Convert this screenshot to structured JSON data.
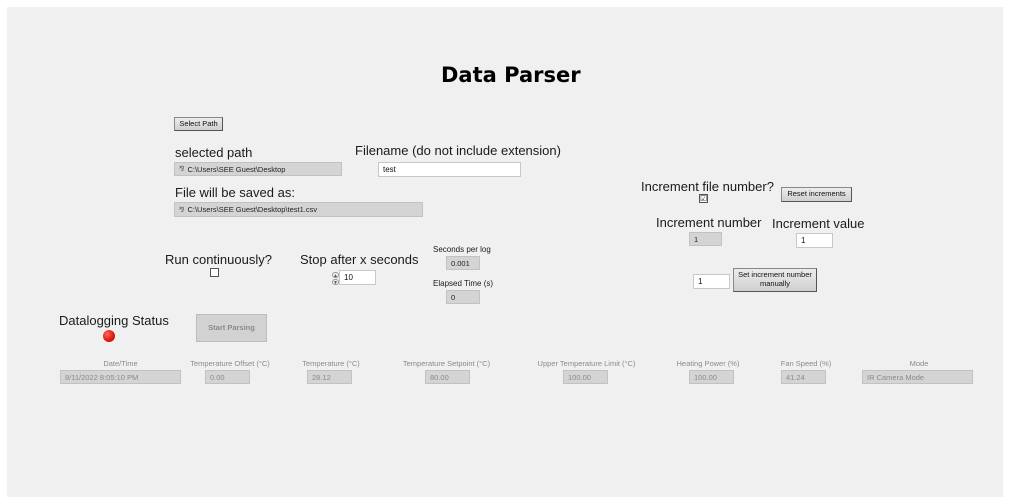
{
  "title": "Data Parser",
  "select_path_button": "Select Path",
  "selected_path": {
    "label": "selected path",
    "value": "C:\\Users\\SEE Guest\\Desktop"
  },
  "filename": {
    "label": "Filename (do not include extension)",
    "value": "test"
  },
  "saved_as": {
    "label": "File will be saved as:",
    "value": "C:\\Users\\SEE Guest\\Desktop\\test1.csv"
  },
  "increment": {
    "question": "Increment file number?",
    "checked": "☑",
    "reset_button": "Reset increments",
    "number_label": "Increment number",
    "number_value": "1",
    "value_label": "Increment value",
    "value_value": "1",
    "manual_value": "1",
    "manual_button": "Set increment number manually"
  },
  "run_continuously": {
    "label": "Run continuously?"
  },
  "stop_after": {
    "label": "Stop after x seconds",
    "value": "10"
  },
  "seconds_per_log": {
    "label": "Seconds per log",
    "value": "0.001"
  },
  "elapsed_time": {
    "label": "Elapsed Time (s)",
    "value": "0"
  },
  "datalogging": {
    "label": "Datalogging Status",
    "led_color": "#e01b10"
  },
  "start_button": "Start Parsing",
  "columns": [
    {
      "header": "Date/Time",
      "value": "8/11/2022 8:05:10 PM"
    },
    {
      "header": "Temperature Offset (°C)",
      "value": "0.00"
    },
    {
      "header": "Temperature (°C)",
      "value": "28.12"
    },
    {
      "header": "Temperature Setpoint (°C)",
      "value": "80.00"
    },
    {
      "header": "Upper Temperature Limit (°C)",
      "value": "100.00"
    },
    {
      "header": "Heating Power (%)",
      "value": "100.00"
    },
    {
      "header": "Fan Speed (%)",
      "value": "41.24"
    },
    {
      "header": "Mode",
      "value": "IR Camera Mode"
    }
  ]
}
